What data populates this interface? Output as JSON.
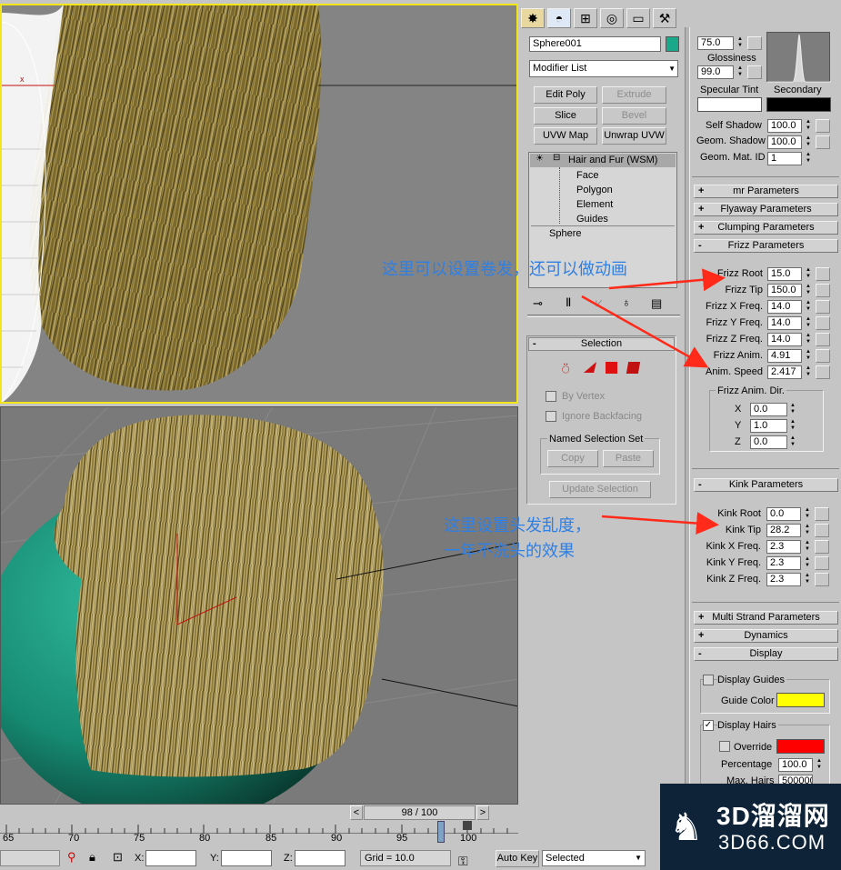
{
  "top_tabs": {
    "create": "create-icon",
    "modify": "modify-icon",
    "hierarchy": "hierarchy-icon",
    "motion": "motion-icon",
    "display": "display-icon",
    "utilities": "hammer-icon"
  },
  "object": {
    "name": "Sphere001",
    "color": "#1aa88a"
  },
  "modifier_list": {
    "label": "Modifier List"
  },
  "modifier_buttons": [
    {
      "label": "Edit Poly",
      "enabled": true
    },
    {
      "label": "Extrude",
      "enabled": false
    },
    {
      "label": "Slice",
      "enabled": true
    },
    {
      "label": "Bevel",
      "enabled": false
    },
    {
      "label": "UVW Map",
      "enabled": true
    },
    {
      "label": "Unwrap UVW",
      "enabled": true
    }
  ],
  "stack": {
    "modifier": "Hair and Fur (WSM)",
    "sub": [
      "Face",
      "Polygon",
      "Element",
      "Guides"
    ],
    "base": "Sphere"
  },
  "selection": {
    "title": "Selection",
    "by_vertex": "By Vertex",
    "ignore_backfacing": "Ignore Backfacing",
    "named_set_title": "Named Selection Set",
    "copy": "Copy",
    "paste": "Paste",
    "update": "Update Selection"
  },
  "material": {
    "specular_value": "75.0",
    "glossiness_label": "Glossiness",
    "glossiness": "99.0",
    "specular_tint": "Specular Tint",
    "secondary": "Secondary",
    "self_shadow_label": "Self Shadow",
    "self_shadow": "100.0",
    "geom_shadow_label": "Geom. Shadow",
    "geom_shadow": "100.0",
    "geom_mat_id_label": "Geom. Mat. ID",
    "geom_mat_id": "1"
  },
  "rollouts": {
    "mr": "mr Parameters",
    "flyaway": "Flyaway Parameters",
    "clumping": "Clumping Parameters",
    "frizz": "Frizz Parameters",
    "kink": "Kink Parameters",
    "multi_strand": "Multi Strand Parameters",
    "dynamics": "Dynamics",
    "display": "Display"
  },
  "frizz": [
    {
      "label": "Frizz Root",
      "value": "15.0"
    },
    {
      "label": "Frizz Tip",
      "value": "150.0"
    },
    {
      "label": "Frizz X Freq.",
      "value": "14.0"
    },
    {
      "label": "Frizz Y Freq.",
      "value": "14.0"
    },
    {
      "label": "Frizz Z Freq.",
      "value": "14.0"
    },
    {
      "label": "Frizz Anim.",
      "value": "4.91"
    },
    {
      "label": "Anim. Speed",
      "value": "2.417"
    }
  ],
  "frizz_dir": {
    "title": "Frizz Anim. Dir.",
    "x_label": "X",
    "x": "0.0",
    "y_label": "Y",
    "y": "1.0",
    "z_label": "Z",
    "z": "0.0"
  },
  "kink": [
    {
      "label": "Kink Root",
      "value": "0.0"
    },
    {
      "label": "Kink Tip",
      "value": "28.2"
    },
    {
      "label": "Kink X Freq.",
      "value": "2.3"
    },
    {
      "label": "Kink Y Freq.",
      "value": "2.3"
    },
    {
      "label": "Kink Z Freq.",
      "value": "2.3"
    }
  ],
  "display": {
    "display_guides": "Display Guides",
    "guide_color_label": "Guide Color",
    "guide_color": "#ffff00",
    "display_hairs": "Display Hairs",
    "override": "Override",
    "override_color": "#ff0000",
    "percentage_label": "Percentage",
    "percentage": "100.0",
    "max_hairs_label": "Max. Hairs",
    "max_hairs": "500000"
  },
  "annotations": {
    "note1": "这里可以设置卷发，还可以做动画",
    "note2_line1": "这里设置头发乱度，",
    "note2_line2": "一年不洗头的效果",
    "arrow_color": "#ff2a1a"
  },
  "timeline": {
    "frame": "98 / 100",
    "ticks": [
      "65",
      "70",
      "75",
      "80",
      "85",
      "90",
      "95",
      "100"
    ],
    "current_frame": 98
  },
  "status": {
    "x_label": "X:",
    "y_label": "Y:",
    "z_label": "Z:",
    "grid": "Grid = 10.0",
    "auto_key": "Auto Key",
    "selected": "Selected"
  },
  "watermark": {
    "brand": "3D溜溜网",
    "url": "3D66.COM"
  }
}
